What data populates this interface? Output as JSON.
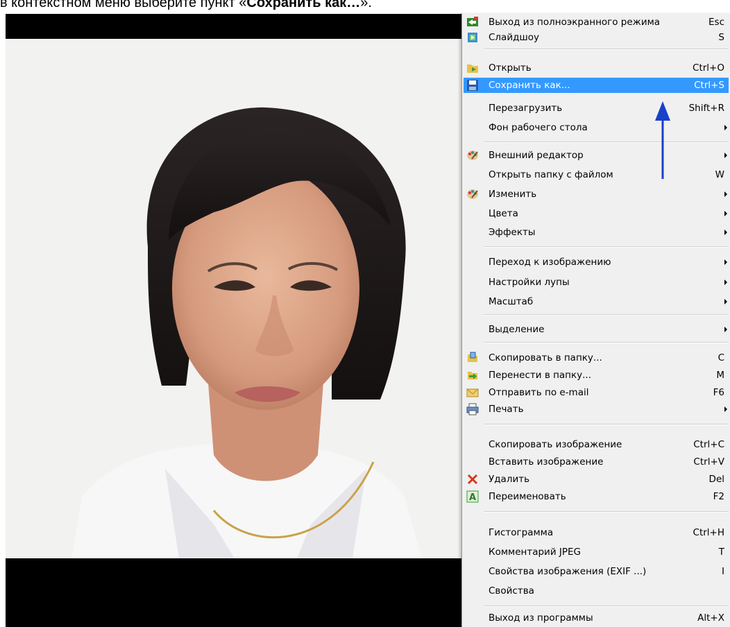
{
  "caption": {
    "prefix": "в контекстном меню выберите пункт «",
    "bold": "Сохранить как…",
    "suffix": "»."
  },
  "menu": {
    "items": [
      {
        "label": "Выход из полноэкранного режима",
        "shortcut": "Esc",
        "icon": "exit-fullscreen-icon"
      },
      {
        "label": "Слайдшоу",
        "shortcut": "S",
        "icon": "slideshow-icon"
      },
      {
        "label": "Открыть",
        "shortcut": "Ctrl+O",
        "icon": "open-folder-icon"
      },
      {
        "label": "Сохранить как...",
        "shortcut": "Ctrl+S",
        "icon": "save-icon",
        "highlighted": true
      },
      {
        "label": "Перезагрузить",
        "shortcut": "Shift+R"
      },
      {
        "label": "Фон рабочего стола",
        "submenu": true
      },
      {
        "label": "Внешний редактор",
        "submenu": true,
        "icon": "palette-icon"
      },
      {
        "label": "Открыть папку с файлом",
        "shortcut": "W"
      },
      {
        "label": "Изменить",
        "submenu": true,
        "icon": "palette-icon"
      },
      {
        "label": "Цвета",
        "submenu": true
      },
      {
        "label": "Эффекты",
        "submenu": true
      },
      {
        "label": "Переход к изображению",
        "submenu": true
      },
      {
        "label": "Настройки лупы",
        "submenu": true
      },
      {
        "label": "Масштаб",
        "submenu": true
      },
      {
        "label": "Выделение",
        "submenu": true
      },
      {
        "label": "Скопировать в папку...",
        "shortcut": "C",
        "icon": "copy-to-folder-icon"
      },
      {
        "label": "Перенести в папку...",
        "shortcut": "M",
        "icon": "move-to-folder-icon"
      },
      {
        "label": "Отправить по e-mail",
        "shortcut": "F6",
        "icon": "email-icon"
      },
      {
        "label": "Печать",
        "submenu": true,
        "icon": "printer-icon"
      },
      {
        "label": "Скопировать изображение",
        "shortcut": "Ctrl+C"
      },
      {
        "label": "Вставить изображение",
        "shortcut": "Ctrl+V"
      },
      {
        "label": "Удалить",
        "shortcut": "Del",
        "icon": "delete-x-icon"
      },
      {
        "label": "Переименовать",
        "shortcut": "F2",
        "icon": "rename-icon"
      },
      {
        "label": "Гистограмма",
        "shortcut": "Ctrl+H"
      },
      {
        "label": "Комментарий JPEG",
        "shortcut": "T"
      },
      {
        "label": "Свойства изображения (EXIF ...)",
        "shortcut": "I"
      },
      {
        "label": "Свойства"
      },
      {
        "label": "Выход из программы",
        "shortcut": "Alt+X"
      }
    ]
  },
  "colors": {
    "highlight": "#3399ff",
    "annotation_arrow": "#1a3fc9",
    "menu_background": "#f0f0f0"
  }
}
